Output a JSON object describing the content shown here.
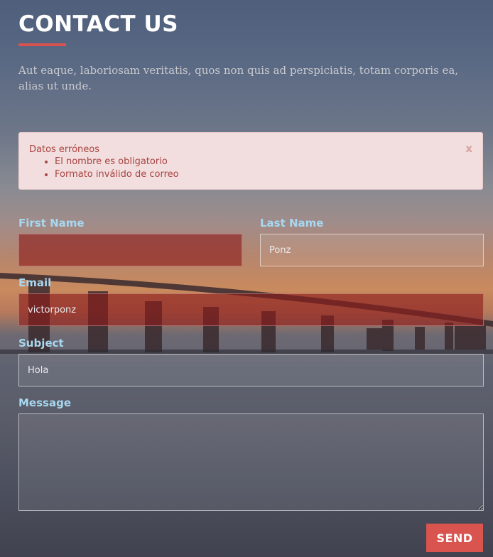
{
  "page": {
    "title": "CONTACT US",
    "intro": "Aut eaque, laboriosam veritatis, quos non quis ad perspiciatis, totam corporis ea, alias ut unde."
  },
  "alert": {
    "heading": "Datos erróneos",
    "errors": [
      "El nombre es obligatorio",
      "Formato inválido de correo"
    ],
    "close": "x"
  },
  "form": {
    "first_name": {
      "label": "First Name",
      "value": ""
    },
    "last_name": {
      "label": "Last Name",
      "value": "Ponz"
    },
    "email": {
      "label": "Email",
      "value": "victorponz"
    },
    "subject": {
      "label": "Subject",
      "value": "Hola"
    },
    "message": {
      "label": "Message",
      "value": ""
    },
    "send_label": "SEND"
  },
  "colors": {
    "accent": "#d9534f",
    "label": "#a7d8f0",
    "alert_bg": "#f2dede",
    "alert_text": "#a94442",
    "error_field": "#8c1c1c"
  }
}
